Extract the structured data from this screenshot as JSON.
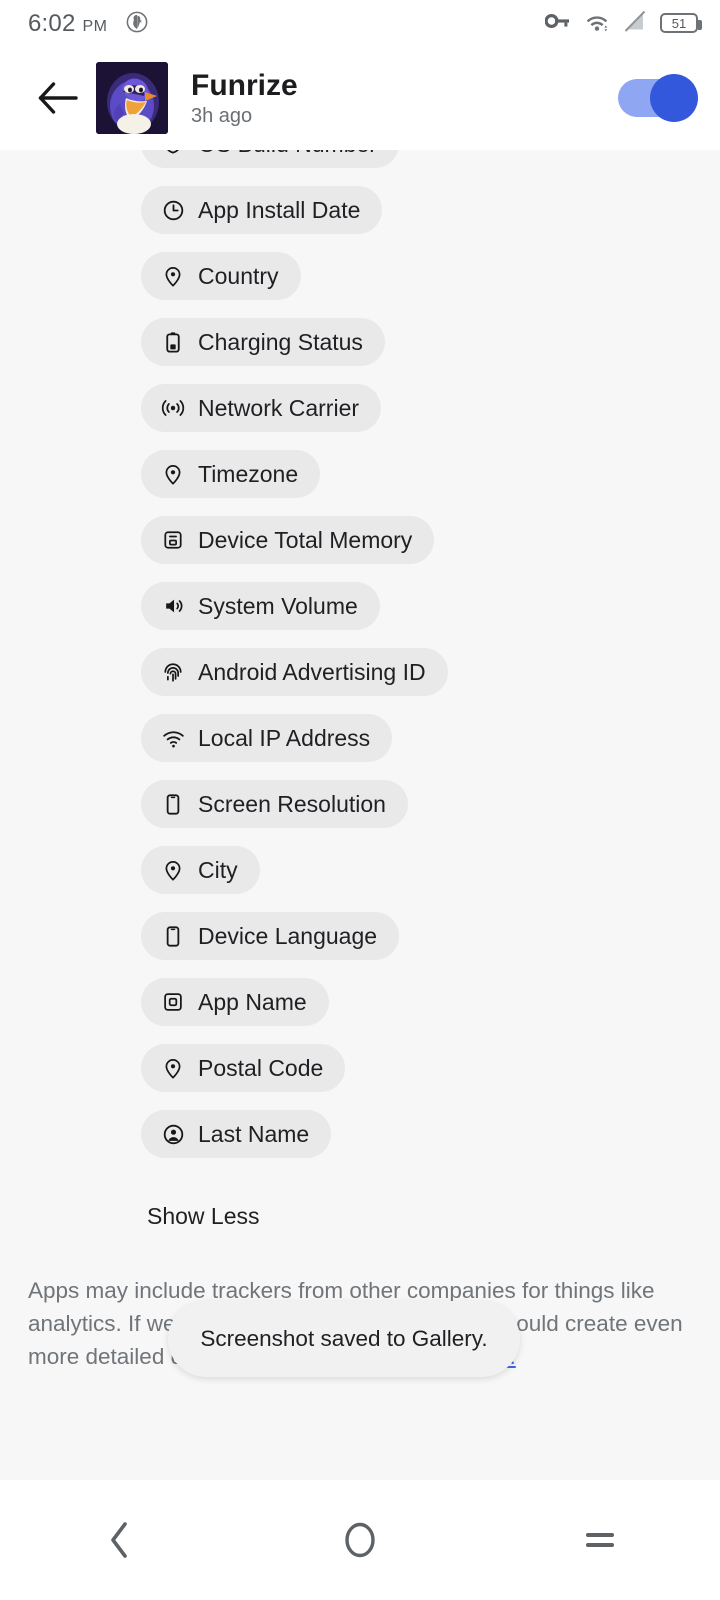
{
  "status_bar": {
    "time": "6:02",
    "ampm": "PM",
    "notification_icon": "duckduckgo-icon",
    "vpn_icon": "vpn-key-icon",
    "wifi_icon": "wifi-icon",
    "signal_icon": "signal-off-icon",
    "battery_level": "51"
  },
  "app_bar": {
    "back_icon": "back-arrow-icon",
    "avatar_icon": "app-avatar-penguin",
    "title": "Funrize",
    "subtitle": "3h ago",
    "toggle_state": "on",
    "toggle_on_color": "#3458dc",
    "toggle_track_color": "#8fa6f2"
  },
  "tracker_chips": [
    {
      "label": "OS Build Number",
      "icon": "shield-check-icon"
    },
    {
      "label": "App Install Date",
      "icon": "clock-icon"
    },
    {
      "label": "Country",
      "icon": "location-pin-icon"
    },
    {
      "label": "Charging Status",
      "icon": "battery-icon"
    },
    {
      "label": "Network Carrier",
      "icon": "broadcast-icon"
    },
    {
      "label": "Timezone",
      "icon": "location-pin-icon"
    },
    {
      "label": "Device Total Memory",
      "icon": "memory-chip-icon"
    },
    {
      "label": "System Volume",
      "icon": "volume-icon"
    },
    {
      "label": "Android Advertising ID",
      "icon": "fingerprint-icon"
    },
    {
      "label": "Local IP Address",
      "icon": "wifi-icon"
    },
    {
      "label": "Screen Resolution",
      "icon": "phone-icon"
    },
    {
      "label": "City",
      "icon": "location-pin-icon"
    },
    {
      "label": "Device Language",
      "icon": "phone-icon"
    },
    {
      "label": "App Name",
      "icon": "app-square-icon"
    },
    {
      "label": "Postal Code",
      "icon": "location-pin-icon"
    },
    {
      "label": "Last Name",
      "icon": "person-circle-icon"
    }
  ],
  "show_less_label": "Show Less",
  "footer": {
    "text_before_link": "Apps may include trackers from other companies for things like analytics. If we don't block them, these trackers could create even more detailed digital profiles on you. ",
    "link_label": "Learn more."
  },
  "toast": {
    "message": "Screenshot saved to Gallery."
  },
  "nav_bar": {
    "back_icon": "nav-back-icon",
    "home_icon": "nav-home-icon",
    "recents_icon": "nav-recents-icon"
  }
}
